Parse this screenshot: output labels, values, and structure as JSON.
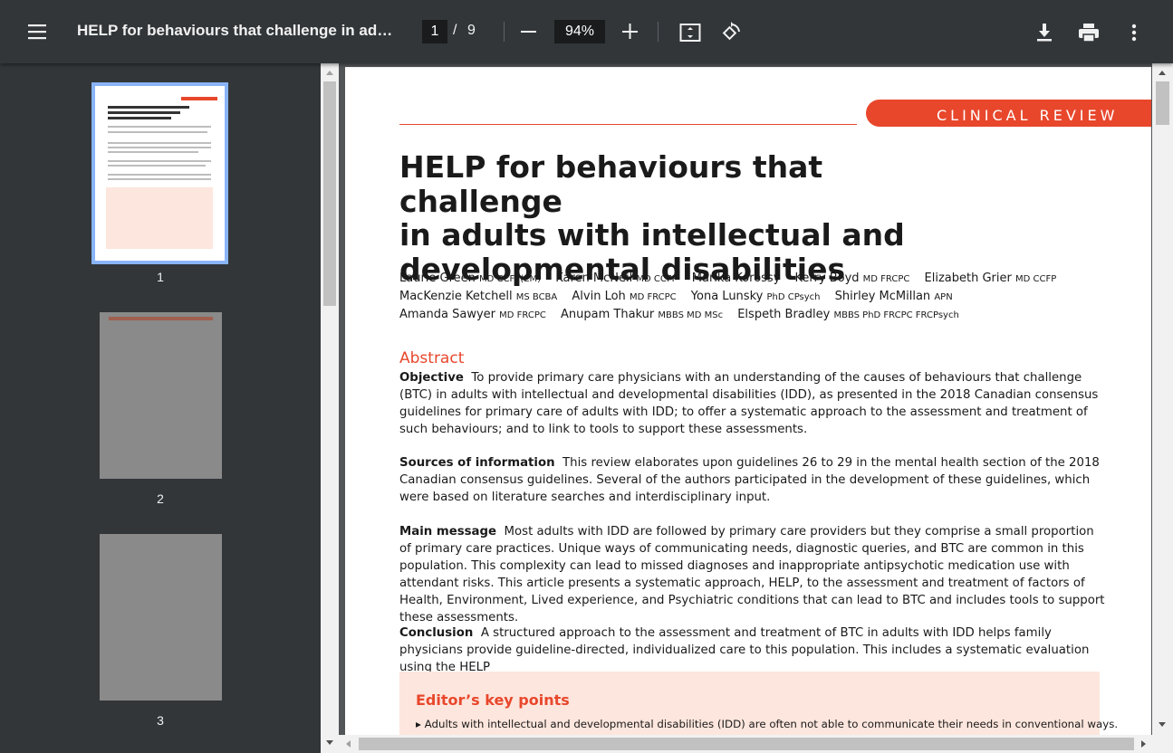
{
  "toolbar": {
    "menu_icon": "hamburger-menu-icon",
    "title": "HELP for behaviours that challenge in adults with intellectual and developmental disabilities",
    "current_page": "1",
    "page_separator": "/",
    "total_pages": "9",
    "zoom_out_icon": "minus-icon",
    "zoom_level": "94%",
    "zoom_in_icon": "plus-icon",
    "fit_icon": "fit-to-page-icon",
    "rotate_icon": "rotate-icon",
    "download_icon": "download-icon",
    "print_icon": "print-icon",
    "more_icon": "more-vert-icon"
  },
  "sidebar": {
    "thumbnails": [
      {
        "label": "1",
        "selected": true
      },
      {
        "label": "2",
        "selected": false
      },
      {
        "label": "3",
        "selected": false
      }
    ]
  },
  "document": {
    "banner": "CLINICAL REVIEW",
    "title_lines": [
      "HELP for behaviours that challenge",
      "in adults with intellectual and",
      "developmental disabilities"
    ],
    "authors": [
      {
        "name": "Laurie Green",
        "creds": "MD CCFP(EM)"
      },
      {
        "name": "Karen McNeil",
        "creds": "MD CCFP"
      },
      {
        "name": "Marika Korossy",
        "creds": ""
      },
      {
        "name": "Kerry Boyd",
        "creds": "MD FRCPC"
      },
      {
        "name": "Elizabeth Grier",
        "creds": "MD CCFP"
      },
      {
        "name": "MacKenzie Ketchell",
        "creds": "MS BCBA"
      },
      {
        "name": "Alvin Loh",
        "creds": "MD FRCPC"
      },
      {
        "name": "Yona Lunsky",
        "creds": "PhD CPsych"
      },
      {
        "name": "Shirley McMillan",
        "creds": "APN"
      },
      {
        "name": "Amanda Sawyer",
        "creds": "MD FRCPC"
      },
      {
        "name": "Anupam Thakur",
        "creds": "MBBS MD MSc"
      },
      {
        "name": "Elspeth Bradley",
        "creds": "MBBS PhD FRCPC FRCPsych"
      }
    ],
    "abstract_heading": "Abstract",
    "sections": [
      {
        "heading": "Objective",
        "text": "To provide primary care physicians with an understanding of the causes of behaviours that challenge (BTC) in adults with intellectual and developmental disabilities (IDD), as presented in the 2018 Canadian consensus guidelines for primary care of adults with IDD; to offer a systematic approach to the assessment and treatment of such behaviours; and to link to tools to support these assessments."
      },
      {
        "heading": "Sources of information",
        "text": "This review elaborates upon guidelines 26 to 29 in the mental health section of the 2018 Canadian consensus guidelines. Several of the authors participated in the development of these guidelines, which were based on literature searches and interdisciplinary input."
      },
      {
        "heading": "Main message",
        "text": "Most adults with IDD are followed by primary care providers but they comprise a small proportion of primary care practices. Unique ways of communicating needs, diagnostic queries, and BTC are common in this population. This complexity can lead to missed diagnoses and inappropriate antipsychotic medication use with attendant risks. This article presents a systematic approach, HELP, to the assessment and treatment of factors of Health, Environment, Lived experience, and Psychiatric conditions that can lead to BTC and includes tools to support these assessments."
      },
      {
        "heading": "Conclusion",
        "text": "A structured approach to the assessment and treatment of BTC in adults with IDD helps family physicians provide guideline-directed, individualized care to this population. This includes a systematic evaluation using the HELP"
      }
    ],
    "key_points_heading": "Editor’s key points",
    "key_point_1": "Adults with intellectual and developmental disabilities (IDD) are often not able to communicate their needs in conventional ways."
  }
}
